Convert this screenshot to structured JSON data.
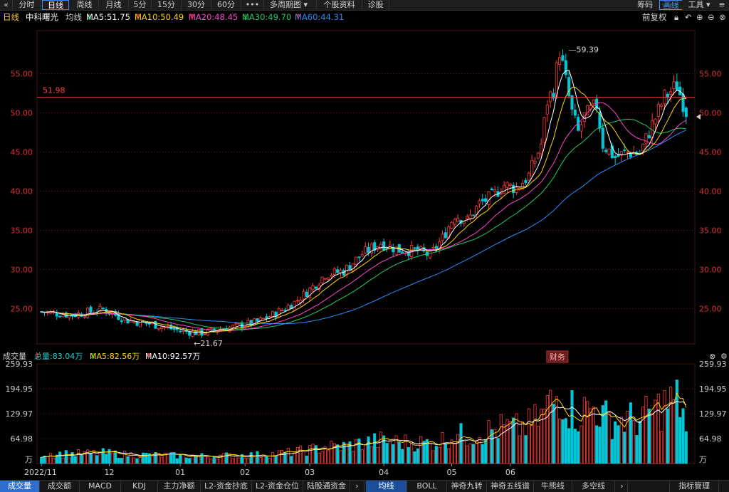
{
  "toolbar": {
    "back_icon": "chevron-left-icon",
    "periods": [
      "分时",
      "日线",
      "周线",
      "月线",
      "5分",
      "15分",
      "30分",
      "60分"
    ],
    "active_period": "日线",
    "more_label": "•••",
    "multi_period_label": "多周期图",
    "stock_info_label": "个股资料",
    "diagnose_label": "诊股",
    "right_items": [
      "筹码",
      "画线",
      "工具"
    ],
    "active_right": "画线"
  },
  "infobar": {
    "period": "日线",
    "stock_name": "中科曙光",
    "ma_label": "均线",
    "ma5": "MA5:51.75",
    "ma10": "MA10:50.49",
    "ma20": "MA20:48.45",
    "ma30": "MA30:49.70",
    "ma60": "MA60:44.31",
    "adjust_label": "前复权"
  },
  "colors": {
    "up": "#ff3b3b",
    "down": "#00c8d8",
    "ma5": "#ffffff",
    "ma10": "#ffd400",
    "ma20": "#ff44cc",
    "ma30": "#22cc66",
    "ma60": "#2a8cff",
    "grid": "#3a1010",
    "axis_text": "#e03030"
  },
  "price_axis": {
    "ticks": [
      "55.00",
      "50.00",
      "45.00",
      "40.00",
      "35.00",
      "30.00",
      "25.00"
    ],
    "ref_line_label": "51.98",
    "high_label": "59.39",
    "low_label": "21.67",
    "event_label": "财务"
  },
  "volume_bar": {
    "title": "成交量",
    "total": "总量:83.04万",
    "ma5": "MA5:82.56万",
    "ma10": "MA10:92.57万",
    "ticks": [
      "259.93",
      "194.95",
      "129.97",
      "64.98",
      "万"
    ]
  },
  "x_axis": [
    "2022/11",
    "12",
    "01",
    "02",
    "03",
    "04",
    "05",
    "06"
  ],
  "bottom_tabs": [
    "成交量",
    "成交额",
    "MACD",
    "KDJ",
    "主力净额",
    "L2-资金抄底",
    "L2-资金仓位",
    "陆股通资金",
    "均线",
    "BOLL",
    "神奇九转",
    "神奇五线谱",
    "牛熊线",
    "多空线",
    "指标管理"
  ],
  "active_bottom_tab": "成交量",
  "active_bottom_tab2": "均线",
  "chart_data": {
    "type": "candlestick",
    "ylim": [
      20.5,
      60.5
    ],
    "ma_values": {
      "ma5": 51.75,
      "ma10": 50.49,
      "ma20": 48.45,
      "ma30": 49.7,
      "ma60": 44.31
    },
    "ohlc_anchors": [
      [
        0,
        24.6
      ],
      [
        10,
        24.2
      ],
      [
        20,
        24.9
      ],
      [
        28,
        23.5
      ],
      [
        36,
        23.0
      ],
      [
        46,
        22.1
      ],
      [
        52,
        21.9
      ],
      [
        58,
        22.4
      ],
      [
        64,
        22.8
      ],
      [
        70,
        23.3
      ],
      [
        76,
        24.4
      ],
      [
        82,
        25.8
      ],
      [
        88,
        27.8
      ],
      [
        92,
        29.4
      ],
      [
        98,
        29.8
      ],
      [
        104,
        32.0
      ],
      [
        110,
        33.4
      ],
      [
        116,
        32.5
      ],
      [
        122,
        32.4
      ],
      [
        126,
        31.8
      ],
      [
        130,
        34.0
      ],
      [
        134,
        37.0
      ],
      [
        138,
        36.2
      ],
      [
        142,
        38.4
      ],
      [
        146,
        39.3
      ],
      [
        150,
        40.8
      ],
      [
        154,
        40.4
      ],
      [
        158,
        42.0
      ],
      [
        162,
        46.0
      ],
      [
        164,
        51.5
      ],
      [
        166,
        53.0
      ],
      [
        168,
        58.0
      ],
      [
        170,
        54.0
      ],
      [
        172,
        50.0
      ],
      [
        174,
        47.5
      ],
      [
        176,
        49.5
      ],
      [
        180,
        51.0
      ],
      [
        182,
        46.0
      ],
      [
        186,
        44.3
      ],
      [
        190,
        45.0
      ],
      [
        194,
        44.8
      ],
      [
        198,
        48.5
      ],
      [
        202,
        52.0
      ],
      [
        206,
        53.5
      ],
      [
        209,
        50.2
      ]
    ],
    "n_bars": 210,
    "volume_ylim": [
      0,
      259.93
    ],
    "volume_ma5_last": 82.56,
    "volume_ma10_last": 92.57,
    "volume_last": 83.04
  }
}
